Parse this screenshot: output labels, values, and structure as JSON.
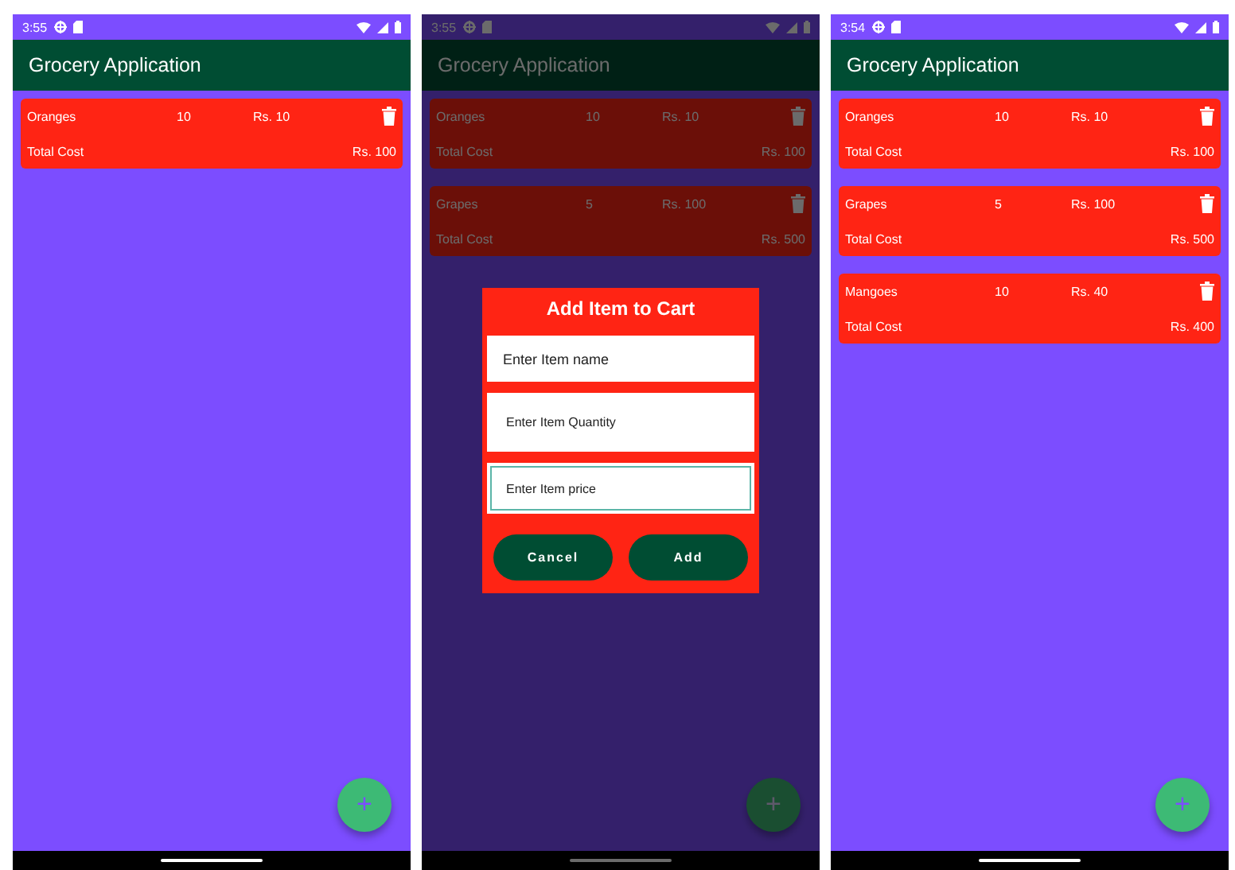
{
  "screens": [
    {
      "status_time": "3:55",
      "dimmed": false,
      "app_title": "Grocery Application",
      "items": [
        {
          "name": "Oranges",
          "quantity": "10",
          "price": "Rs. 10",
          "total_label": "Total Cost",
          "total": "Rs. 100"
        }
      ],
      "fab": "+"
    },
    {
      "status_time": "3:55",
      "dimmed": true,
      "app_title": "Grocery Application",
      "items": [
        {
          "name": "Oranges",
          "quantity": "10",
          "price": "Rs. 10",
          "total_label": "Total Cost",
          "total": "Rs. 100"
        },
        {
          "name": "Grapes",
          "quantity": "5",
          "price": "Rs. 100",
          "total_label": "Total Cost",
          "total": "Rs. 500"
        }
      ],
      "fab": "+",
      "dialog": {
        "title": "Add Item to Cart",
        "fields": [
          {
            "placeholder": "Enter Item name",
            "focused": false
          },
          {
            "placeholder": "Enter Item Quantity",
            "focused": false
          },
          {
            "placeholder": "Enter Item price",
            "focused": true
          }
        ],
        "buttons": [
          "Cancel",
          "Add"
        ]
      }
    },
    {
      "status_time": "3:54",
      "dimmed": false,
      "app_title": "Grocery Application",
      "items": [
        {
          "name": "Oranges",
          "quantity": "10",
          "price": "Rs. 10",
          "total_label": "Total Cost",
          "total": "Rs. 100"
        },
        {
          "name": "Grapes",
          "quantity": "5",
          "price": "Rs. 100",
          "total_label": "Total Cost",
          "total": "Rs. 500"
        },
        {
          "name": "Mangoes",
          "quantity": "10",
          "price": "Rs. 40",
          "total_label": "Total Cost",
          "total": "Rs. 400"
        }
      ],
      "fab": "+"
    }
  ]
}
